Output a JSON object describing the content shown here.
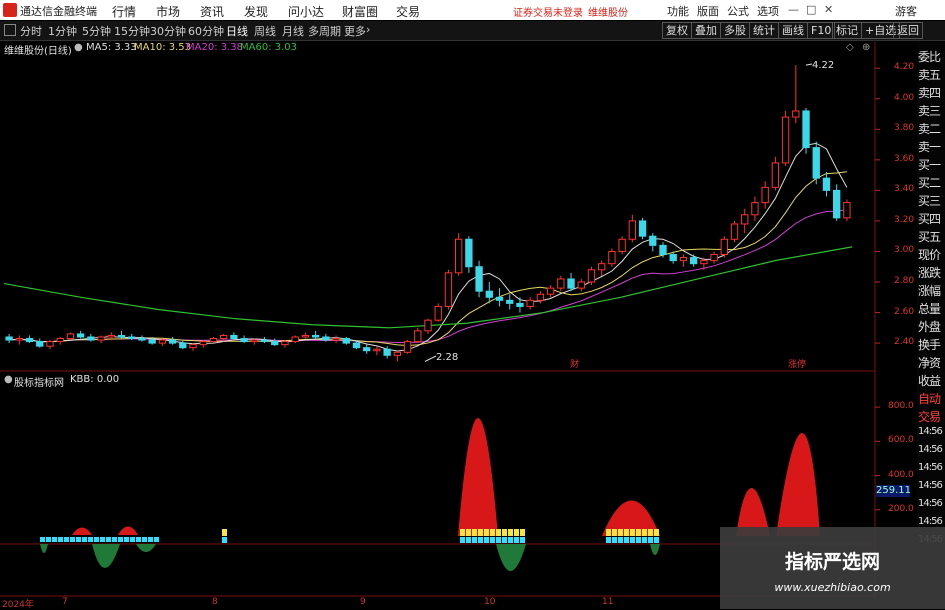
{
  "menubar": {
    "app_title": "通达信金融终端",
    "menus": [
      "行情",
      "市场",
      "资讯",
      "发现",
      "问小达",
      "财富圈",
      "交易"
    ],
    "login_text": "证券交易未登录",
    "stock_name": "维维股份",
    "right_menus": [
      "功能",
      "版面",
      "公式",
      "选项"
    ],
    "guest": "游客"
  },
  "toolbar": {
    "periods": [
      "分时",
      "1分钟",
      "5分钟",
      "15分钟",
      "30分钟",
      "60分钟",
      "日线",
      "周线",
      "月线",
      "多周期",
      "更多"
    ],
    "active_period": "日线",
    "right_buttons": [
      "复权",
      "叠加",
      "多股",
      "统计",
      "画线",
      "F10",
      "标记",
      "+自选",
      "返回"
    ]
  },
  "main_chart": {
    "title": "维维股份(日线)",
    "ma5_label": "MA5: 3.33",
    "ma10_label": "MA10: 3.53",
    "ma20_label": "MA20: 3.38",
    "ma60_label": "MA60: 3.03",
    "high_label": "4.22",
    "low_label": "2.28",
    "marker_1": "财",
    "marker_2": "涨停",
    "colors": {
      "up": "#ff3232",
      "down": "#3ad8e8",
      "ma5": "#dddddd",
      "ma10": "#e8d860",
      "ma20": "#d040d0",
      "ma60": "#30c030"
    }
  },
  "sub_chart": {
    "title": "股标指标网",
    "kbb_label": "KBB: 0.00",
    "value_box": "259.11"
  },
  "chart_data": {
    "type": "candlestick",
    "price_axis_ticks": [
      "4.20",
      "4.00",
      "3.80",
      "3.60",
      "3.40",
      "3.20",
      "3.00",
      "2.80",
      "2.60",
      "2.40"
    ],
    "indicator_axis_ticks": [
      "800.0",
      "600.0",
      "400.0",
      "200.0"
    ],
    "x_tick_labels": [
      "2024年",
      "7",
      "8",
      "9",
      "10",
      "11"
    ],
    "ylim": [
      2.25,
      4.28
    ],
    "candles": [
      [
        2.44,
        2.46,
        2.4,
        2.42
      ],
      [
        2.42,
        2.45,
        2.39,
        2.43
      ],
      [
        2.43,
        2.45,
        2.4,
        2.41
      ],
      [
        2.41,
        2.43,
        2.37,
        2.38
      ],
      [
        2.38,
        2.42,
        2.36,
        2.41
      ],
      [
        2.41,
        2.44,
        2.39,
        2.43
      ],
      [
        2.43,
        2.47,
        2.42,
        2.46
      ],
      [
        2.46,
        2.48,
        2.43,
        2.44
      ],
      [
        2.44,
        2.46,
        2.41,
        2.42
      ],
      [
        2.42,
        2.45,
        2.4,
        2.44
      ],
      [
        2.44,
        2.47,
        2.42,
        2.45
      ],
      [
        2.45,
        2.48,
        2.43,
        2.44
      ],
      [
        2.44,
        2.46,
        2.42,
        2.43
      ],
      [
        2.43,
        2.45,
        2.41,
        2.42
      ],
      [
        2.42,
        2.44,
        2.39,
        2.4
      ],
      [
        2.4,
        2.43,
        2.38,
        2.42
      ],
      [
        2.42,
        2.44,
        2.39,
        2.4
      ],
      [
        2.4,
        2.42,
        2.36,
        2.37
      ],
      [
        2.37,
        2.4,
        2.35,
        2.39
      ],
      [
        2.39,
        2.42,
        2.37,
        2.41
      ],
      [
        2.41,
        2.44,
        2.4,
        2.43
      ],
      [
        2.43,
        2.46,
        2.41,
        2.45
      ],
      [
        2.45,
        2.47,
        2.42,
        2.43
      ],
      [
        2.43,
        2.45,
        2.4,
        2.41
      ],
      [
        2.41,
        2.43,
        2.39,
        2.42
      ],
      [
        2.42,
        2.44,
        2.4,
        2.41
      ],
      [
        2.41,
        2.43,
        2.38,
        2.39
      ],
      [
        2.39,
        2.42,
        2.37,
        2.41
      ],
      [
        2.41,
        2.45,
        2.4,
        2.44
      ],
      [
        2.44,
        2.47,
        2.43,
        2.45
      ],
      [
        2.45,
        2.48,
        2.43,
        2.44
      ],
      [
        2.44,
        2.46,
        2.41,
        2.42
      ],
      [
        2.42,
        2.45,
        2.4,
        2.43
      ],
      [
        2.43,
        2.44,
        2.39,
        2.4
      ],
      [
        2.4,
        2.42,
        2.36,
        2.37
      ],
      [
        2.37,
        2.39,
        2.33,
        2.35
      ],
      [
        2.35,
        2.38,
        2.32,
        2.36
      ],
      [
        2.36,
        2.38,
        2.3,
        2.32
      ],
      [
        2.32,
        2.35,
        2.28,
        2.34
      ],
      [
        2.34,
        2.42,
        2.33,
        2.41
      ],
      [
        2.41,
        2.5,
        2.4,
        2.48
      ],
      [
        2.48,
        2.56,
        2.46,
        2.55
      ],
      [
        2.55,
        2.66,
        2.54,
        2.64
      ],
      [
        2.64,
        2.88,
        2.62,
        2.86
      ],
      [
        2.86,
        3.12,
        2.84,
        3.08
      ],
      [
        3.08,
        3.1,
        2.86,
        2.9
      ],
      [
        2.9,
        2.94,
        2.7,
        2.74
      ],
      [
        2.74,
        2.8,
        2.66,
        2.7
      ],
      [
        2.7,
        2.76,
        2.64,
        2.68
      ],
      [
        2.68,
        2.72,
        2.62,
        2.66
      ],
      [
        2.66,
        2.7,
        2.6,
        2.64
      ],
      [
        2.64,
        2.7,
        2.62,
        2.68
      ],
      [
        2.68,
        2.74,
        2.66,
        2.72
      ],
      [
        2.72,
        2.78,
        2.7,
        2.76
      ],
      [
        2.76,
        2.84,
        2.74,
        2.82
      ],
      [
        2.82,
        2.86,
        2.74,
        2.76
      ],
      [
        2.76,
        2.82,
        2.74,
        2.8
      ],
      [
        2.8,
        2.9,
        2.78,
        2.88
      ],
      [
        2.88,
        2.94,
        2.84,
        2.92
      ],
      [
        2.92,
        3.02,
        2.9,
        3.0
      ],
      [
        3.0,
        3.1,
        2.98,
        3.08
      ],
      [
        3.08,
        3.24,
        3.06,
        3.2
      ],
      [
        3.2,
        3.22,
        3.08,
        3.1
      ],
      [
        3.1,
        3.12,
        3.0,
        3.04
      ],
      [
        3.04,
        3.06,
        2.96,
        2.98
      ],
      [
        2.98,
        3.0,
        2.92,
        2.94
      ],
      [
        2.94,
        2.98,
        2.9,
        2.96
      ],
      [
        2.96,
        2.98,
        2.9,
        2.92
      ],
      [
        2.92,
        2.96,
        2.88,
        2.94
      ],
      [
        2.94,
        3.0,
        2.92,
        2.98
      ],
      [
        2.98,
        3.1,
        2.96,
        3.08
      ],
      [
        3.08,
        3.2,
        3.06,
        3.18
      ],
      [
        3.18,
        3.28,
        3.12,
        3.24
      ],
      [
        3.24,
        3.36,
        3.2,
        3.32
      ],
      [
        3.32,
        3.46,
        3.28,
        3.42
      ],
      [
        3.42,
        3.62,
        3.4,
        3.58
      ],
      [
        3.58,
        3.92,
        3.56,
        3.88
      ],
      [
        3.88,
        4.22,
        3.84,
        3.92
      ],
      [
        3.92,
        3.94,
        3.64,
        3.68
      ],
      [
        3.68,
        3.72,
        3.44,
        3.48
      ],
      [
        3.48,
        3.52,
        3.36,
        3.4
      ],
      [
        3.4,
        3.44,
        3.2,
        3.22
      ],
      [
        3.22,
        3.34,
        3.2,
        3.32
      ]
    ],
    "ma60_points": [
      2.79,
      2.7,
      2.62,
      2.56,
      2.52,
      2.5,
      2.53,
      2.6,
      2.7,
      2.82,
      2.94,
      3.03
    ]
  }
}
